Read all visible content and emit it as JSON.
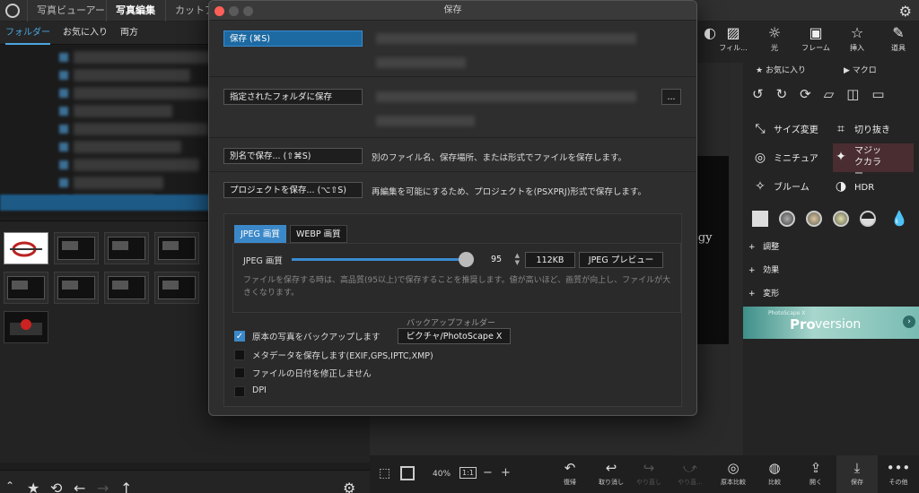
{
  "topbar": {
    "tabs": [
      "写真ビューアー",
      "写真編集",
      "カットア"
    ]
  },
  "left": {
    "subtabs": [
      "フォルダー",
      "お気に入り",
      "両方"
    ]
  },
  "center": {
    "canvas_text": "ogy",
    "zoom": "40%",
    "ratio_label": "1:1",
    "minus": "−",
    "plus": "+"
  },
  "tools": [
    {
      "icon": "filter-icon",
      "label": "フィル..."
    },
    {
      "icon": "light-icon",
      "label": "光"
    },
    {
      "icon": "frame-icon",
      "label": "フレーム"
    },
    {
      "icon": "insert-icon",
      "label": "挿入"
    },
    {
      "icon": "tools-icon",
      "label": "道具"
    }
  ],
  "rightpanel": {
    "tabs": [
      "お気に入り",
      "マクロ"
    ],
    "buttons": [
      {
        "icon": "resize-icon",
        "label": "サイズ変更"
      },
      {
        "icon": "crop-icon",
        "label": "切り抜き"
      },
      {
        "icon": "miniature-icon",
        "label": "ミニチュア"
      },
      {
        "icon": "magic-color-icon",
        "label": "マジックカラー"
      },
      {
        "icon": "bloom-icon",
        "label": "ブルーム"
      },
      {
        "icon": "hdr-icon",
        "label": "HDR"
      }
    ],
    "sections": [
      "調整",
      "効果",
      "変形"
    ],
    "pro_small": "PhotoScape X",
    "pro": "Pro",
    "version": "version"
  },
  "bottom_actions": [
    {
      "icon": "undo-icon",
      "label": "復帰",
      "dim": false
    },
    {
      "icon": "cancel-icon",
      "label": "取り消し",
      "dim": false
    },
    {
      "icon": "redo-icon",
      "label": "やり直し",
      "dim": true
    },
    {
      "icon": "redo-all-icon",
      "label": "やり直...",
      "dim": true
    },
    {
      "icon": "compare-original-icon",
      "label": "原本比較",
      "dim": false
    },
    {
      "icon": "compare-icon",
      "label": "比較",
      "dim": false
    },
    {
      "icon": "open-icon",
      "label": "開く",
      "dim": false
    },
    {
      "icon": "save-icon",
      "label": "保存",
      "dim": false
    },
    {
      "icon": "more-icon",
      "label": "その他",
      "dim": false
    }
  ],
  "dialog": {
    "title": "保存",
    "save_label": "保存 (⌘S)",
    "save_folder_label": "指定されたフォルダに保存",
    "browse_label": "...",
    "save_as_label": "別名で保存... (⇧⌘S)",
    "save_as_desc": "別のファイル名、保存場所、または形式でファイルを保存します。",
    "project_label": "プロジェクトを保存... (⌥⇧S)",
    "project_desc": "再編集を可能にするため、プロジェクトを(PSXPRJ)形式で保存します。",
    "tab_jpeg": "JPEG 画質",
    "tab_webp": "WEBP 画質",
    "quality_label": "JPEG 画質",
    "quality_value": "95",
    "file_size": "112KB",
    "preview_label": "JPEG プレビュー",
    "quality_hint": "ファイルを保存する時は、高品質(95以上)で保存することを推奨します。値が高いほど、画質が向上し、ファイルが大きくなります。",
    "backup_folder_label": "バックアップフォルダー",
    "backup_folder_value": "ピクチャ/PhotoScape X",
    "options": [
      {
        "label": "原本の写真をバックアップします",
        "checked": true
      },
      {
        "label": "メタデータを保存します(EXIF,GPS,IPTC,XMP)",
        "checked": false
      },
      {
        "label": "ファイルの日付を修正しません",
        "checked": false
      },
      {
        "label": "DPI",
        "checked": false
      }
    ]
  },
  "colors": {
    "accent": "#3b88c9",
    "traffic_red": "#ff5f57",
    "traffic_gray": "#5a5a5a"
  }
}
